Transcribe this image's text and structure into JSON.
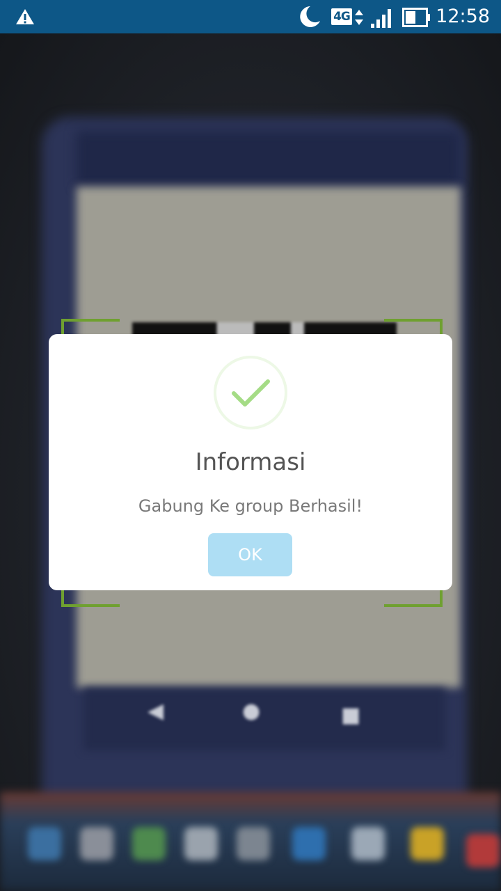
{
  "status_bar": {
    "network_type": "4G",
    "time": "12:58",
    "icons": [
      "warning-icon",
      "moon-icon",
      "data-arrows-icon",
      "signal-icon",
      "battery-icon"
    ]
  },
  "scanner": {
    "frame_color": "#6fa030"
  },
  "dialog": {
    "icon": "check-icon",
    "title": "Informasi",
    "message": "Gabung Ke group Berhasil!",
    "ok_label": "OK",
    "colors": {
      "check": "#a5dc86",
      "ring": "#edf8e6",
      "button": "#aedef4"
    }
  }
}
